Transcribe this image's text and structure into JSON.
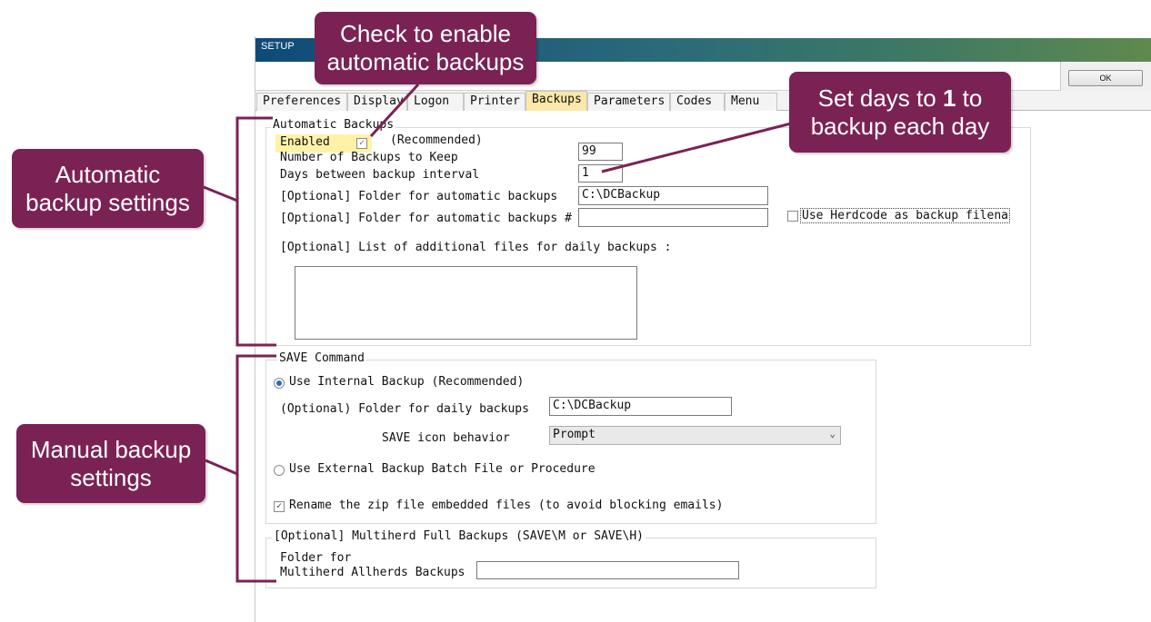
{
  "window": {
    "title": "SETUP",
    "ok_label": "OK"
  },
  "tabs": [
    {
      "label": "Preferences",
      "active": false
    },
    {
      "label": "Display",
      "active": false
    },
    {
      "label": "Logon",
      "active": false
    },
    {
      "label": "Printer",
      "active": false
    },
    {
      "label": "Backups",
      "active": true
    },
    {
      "label": "Parameters",
      "active": false
    },
    {
      "label": "Codes",
      "active": false
    },
    {
      "label": "Menu",
      "active": false
    }
  ],
  "automatic": {
    "legend": "Automatic Backups",
    "enabled_label": "Enabled",
    "enabled_checked": true,
    "recommended": "(Recommended)",
    "num_keep_label": "Number of Backups to Keep",
    "num_keep_value": "99",
    "days_label": "Days between backup interval",
    "days_value": "1",
    "folder_label": "[Optional] Folder for automatic backups",
    "folder_value": "C:\\DCBackup",
    "folder2_label": "[Optional] Folder for automatic backups #",
    "folder2_value": "",
    "herdcode_label": "Use Herdcode as backup filena",
    "herdcode_checked": false,
    "files_label": "[Optional] List of additional files for daily backups :"
  },
  "save": {
    "legend": "SAVE Command",
    "internal_label": "Use Internal Backup (Recommended)",
    "internal_selected": true,
    "daily_folder_label": "(Optional) Folder for daily backups",
    "daily_folder_value": "C:\\DCBackup",
    "icon_label": "SAVE icon behavior",
    "icon_value": "Prompt",
    "external_label": "Use External Backup Batch File or Procedure",
    "external_selected": false,
    "rename_label": "Rename the zip file embedded files (to avoid blocking emails)",
    "rename_checked": true
  },
  "multiherd": {
    "legend": "[Optional] Multiherd Full Backups (SAVE\\M or SAVE\\H)",
    "folder_label_1": "Folder for",
    "folder_label_2": "Multiherd Allherds Backups",
    "folder_value": ""
  },
  "callouts": {
    "enable_line1": "Check to enable",
    "enable_line2": "automatic backups",
    "days_pre": "Set days to ",
    "days_bold": "1",
    "days_post": " to",
    "days_line2": "backup each day",
    "auto_line1": "Automatic",
    "auto_line2": "backup settings",
    "manual_line1": "Manual backup",
    "manual_line2": "settings"
  },
  "colors": {
    "callout": "#7b2254",
    "active_tab": "#fbe7a7",
    "highlight": "#fff2a8"
  }
}
